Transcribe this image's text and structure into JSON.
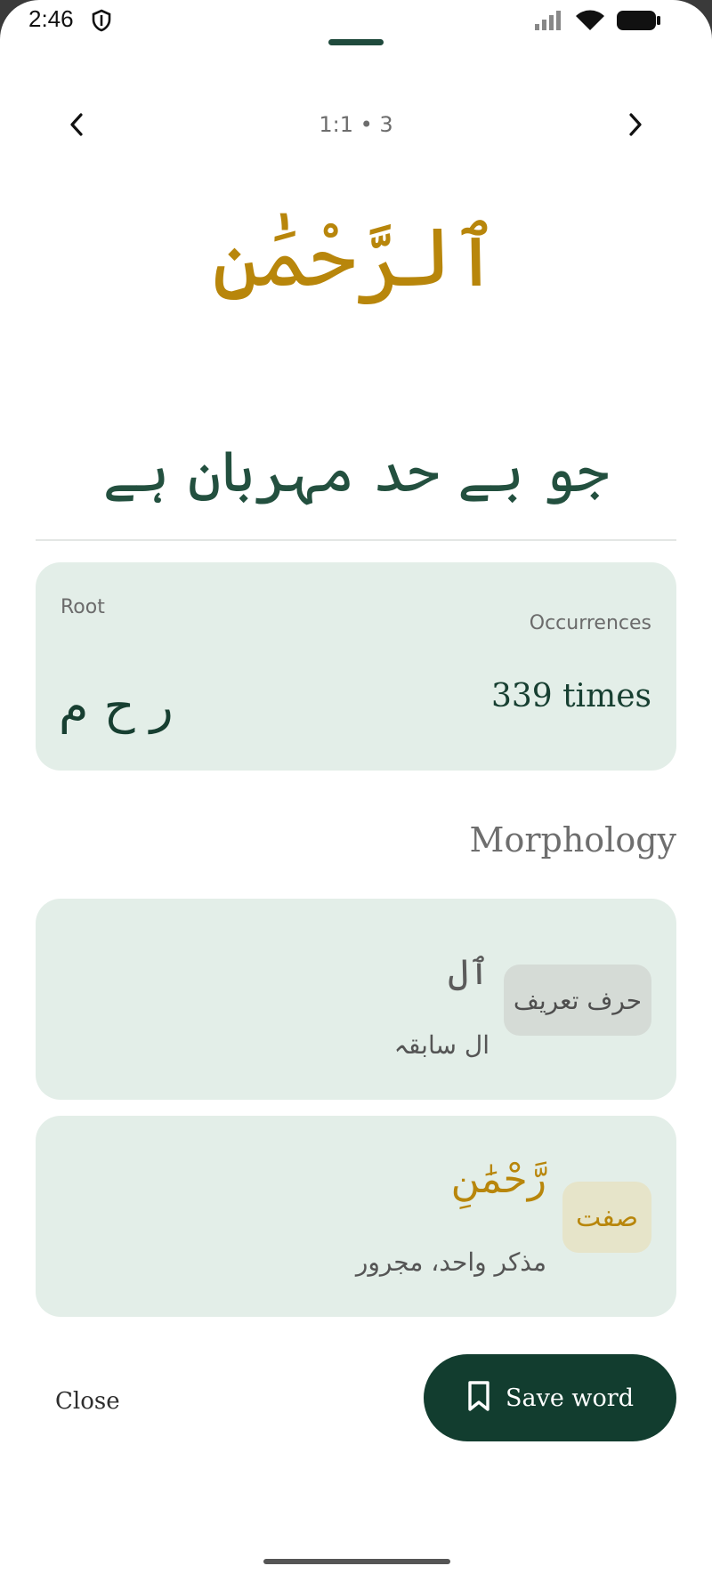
{
  "status": {
    "time": "2:46"
  },
  "nav": {
    "verse_ref": "1:1 • 3"
  },
  "word": {
    "arabic": "ٱلرَّحْمَٰنِ",
    "meaning_urdu": "جو بے حد مہربان ہے"
  },
  "root_card": {
    "root_label": "Root",
    "root_letters": "ر ح م",
    "occurrences_label": "Occurrences",
    "occurrences_value": "339 times"
  },
  "morphology": {
    "heading": "Morphology",
    "segments": [
      {
        "arabic": "ٱل",
        "description": "ال سابقہ",
        "tag": "حرف تعریف"
      },
      {
        "arabic": "رَّحْمَٰنِ",
        "description": "مذکر واحد، مجرور",
        "tag": "صفت"
      }
    ]
  },
  "actions": {
    "close_label": "Close",
    "save_label": "Save word"
  },
  "icons": {
    "status": [
      "shield-icon",
      "signal-icon",
      "wifi-icon",
      "battery-icon"
    ],
    "nav": [
      "chevron-left-icon",
      "chevron-right-icon"
    ],
    "save": "bookmark-icon"
  },
  "colors": {
    "accent_gold": "#b8860b",
    "primary_green": "#123d2f",
    "card_bg": "#e3eee8"
  }
}
